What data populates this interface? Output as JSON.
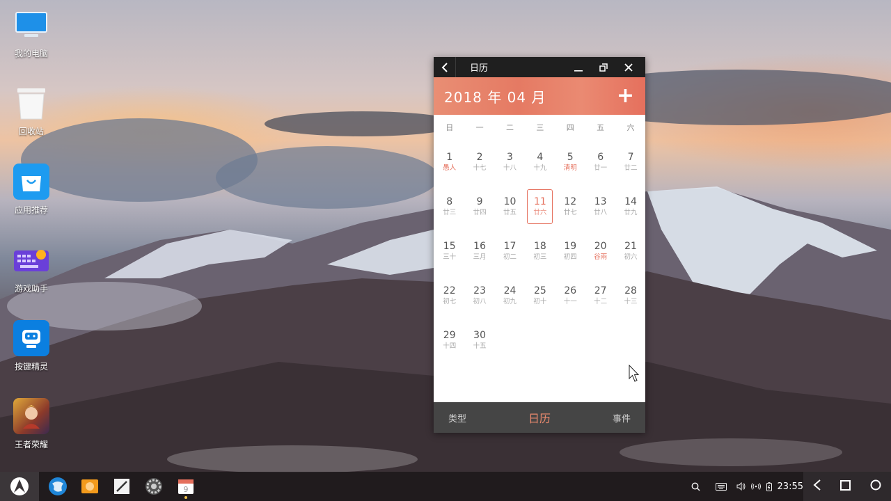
{
  "desktop": {
    "icons": [
      {
        "label": "我的电脑",
        "icon": "computer-icon"
      },
      {
        "label": "回收站",
        "icon": "recycle-bin-icon"
      },
      {
        "label": "应用推荐",
        "icon": "app-store-icon"
      },
      {
        "label": "游戏助手",
        "icon": "game-keyboard-icon"
      },
      {
        "label": "按键精灵",
        "icon": "robot-icon"
      },
      {
        "label": "王者荣耀",
        "icon": "game-hero-icon"
      }
    ]
  },
  "calendar_window": {
    "title": "日历",
    "header": {
      "year": "2018",
      "year_char": "年",
      "month": "04",
      "month_char": "月",
      "add_label": "+"
    },
    "weekdays": [
      "日",
      "一",
      "二",
      "三",
      "四",
      "五",
      "六"
    ],
    "days": [
      {
        "num": "1",
        "lunar": "愚人",
        "festival": true
      },
      {
        "num": "2",
        "lunar": "十七"
      },
      {
        "num": "3",
        "lunar": "十八"
      },
      {
        "num": "4",
        "lunar": "十九"
      },
      {
        "num": "5",
        "lunar": "清明",
        "festival": true
      },
      {
        "num": "6",
        "lunar": "廿一"
      },
      {
        "num": "7",
        "lunar": "廿二"
      },
      {
        "num": "8",
        "lunar": "廿三"
      },
      {
        "num": "9",
        "lunar": "廿四"
      },
      {
        "num": "10",
        "lunar": "廿五"
      },
      {
        "num": "11",
        "lunar": "廿六",
        "today": true
      },
      {
        "num": "12",
        "lunar": "廿七"
      },
      {
        "num": "13",
        "lunar": "廿八"
      },
      {
        "num": "14",
        "lunar": "廿九"
      },
      {
        "num": "15",
        "lunar": "三十"
      },
      {
        "num": "16",
        "lunar": "三月"
      },
      {
        "num": "17",
        "lunar": "初二"
      },
      {
        "num": "18",
        "lunar": "初三"
      },
      {
        "num": "19",
        "lunar": "初四"
      },
      {
        "num": "20",
        "lunar": "谷雨",
        "festival": true
      },
      {
        "num": "21",
        "lunar": "初六"
      },
      {
        "num": "22",
        "lunar": "初七"
      },
      {
        "num": "23",
        "lunar": "初八"
      },
      {
        "num": "24",
        "lunar": "初九"
      },
      {
        "num": "25",
        "lunar": "初十"
      },
      {
        "num": "26",
        "lunar": "十一"
      },
      {
        "num": "27",
        "lunar": "十二"
      },
      {
        "num": "28",
        "lunar": "十三"
      },
      {
        "num": "29",
        "lunar": "十四"
      },
      {
        "num": "30",
        "lunar": "十五"
      }
    ],
    "tabs": [
      {
        "label": "类型",
        "active": false
      },
      {
        "label": "日历",
        "active": true
      },
      {
        "label": "事件",
        "active": false
      }
    ],
    "accent_color": "#e5705d"
  },
  "taskbar": {
    "apps": [
      "browser-icon",
      "folder-icon",
      "notes-icon",
      "settings-icon",
      "calendar-icon"
    ],
    "tray_icons": [
      "search-icon",
      "keyboard-icon",
      "volume-icon",
      "wifi-icon",
      "battery-icon"
    ],
    "clock": "23:55"
  }
}
